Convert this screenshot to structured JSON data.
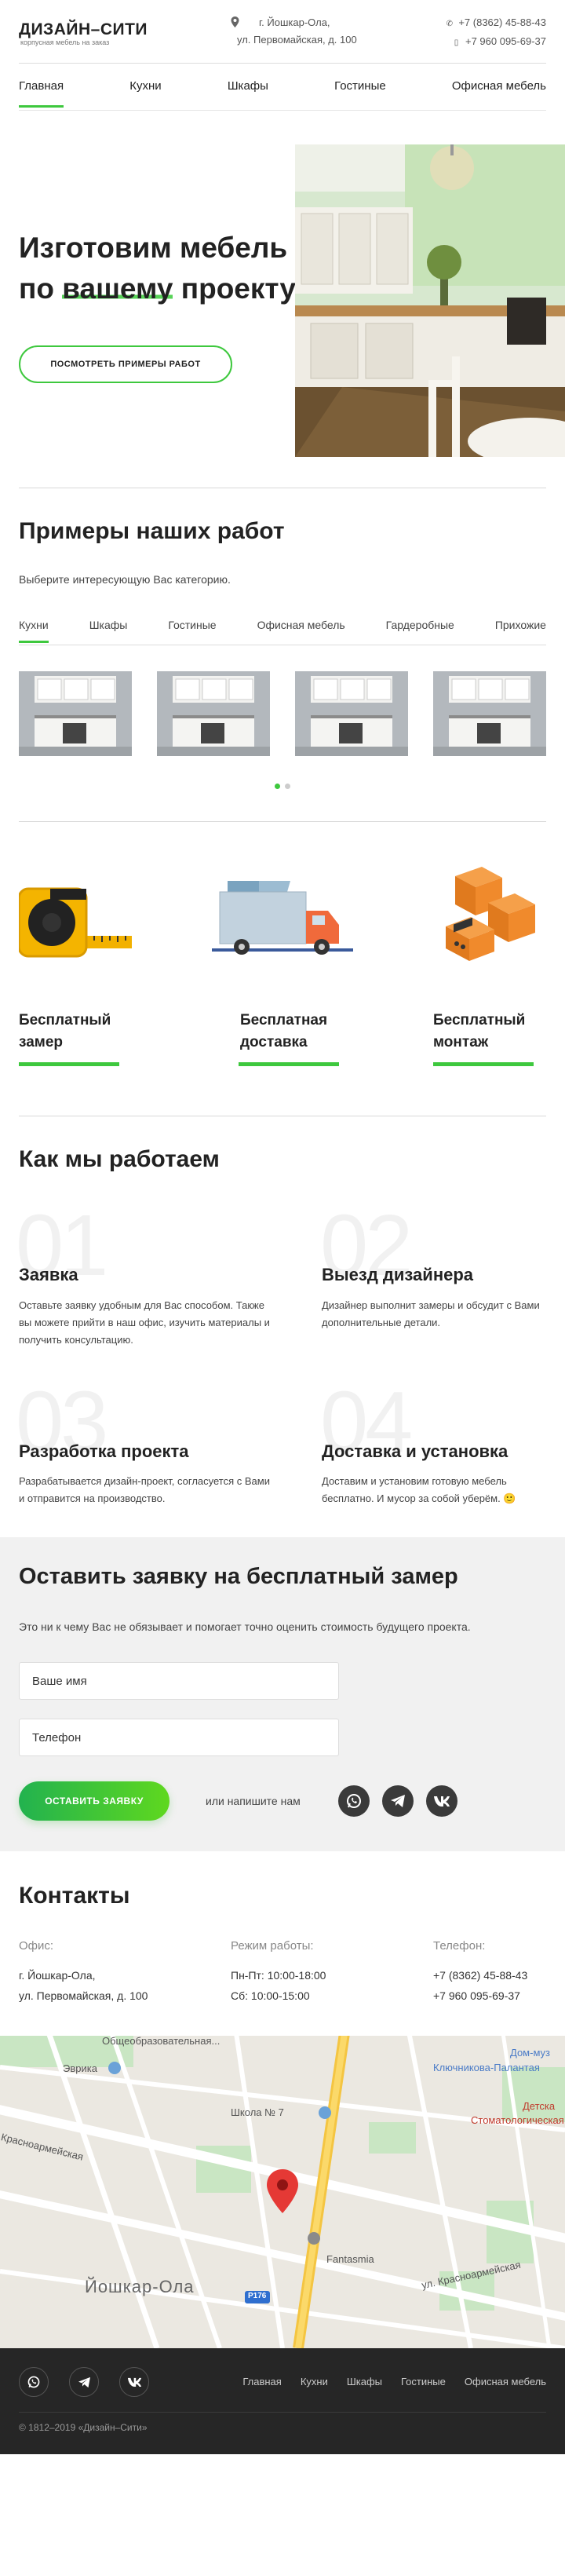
{
  "header": {
    "logo_title": "ДИЗАЙН–СИТИ",
    "logo_subtitle": "корпусная мебель на заказ",
    "address_line1": "г. Йошкар-Ола,",
    "address_line2": "ул. Первомайская, д. 100",
    "phone1": "+7 (8362) 45-88-43",
    "phone2": "+7 960 095-69-37"
  },
  "nav": {
    "items": [
      "Главная",
      "Кухни",
      "Шкафы",
      "Гостиные",
      "Офисная мебель"
    ],
    "active": "Главная"
  },
  "hero": {
    "title_line1": "Изготовим мебель",
    "title_line2_before": "по ",
    "title_line2_highlight": "вашему",
    "title_line2_after": " проекту",
    "button": "ПОСМОТРЕТЬ ПРИМЕРЫ РАБОТ"
  },
  "works": {
    "title": "Примеры наших работ",
    "subtitle": "Выберите интересующую Вас категорию.",
    "tabs": [
      "Кухни",
      "Шкафы",
      "Гостиные",
      "Офисная мебель",
      "Гардеробные",
      "Прихожие"
    ],
    "active_tab": "Кухни",
    "slider_pages": 2,
    "slider_current": 1
  },
  "features": [
    {
      "title": "Бесплатный замер",
      "icon": "tape-measure-icon"
    },
    {
      "title": "Бесплатная доставка",
      "icon": "delivery-truck-icon"
    },
    {
      "title": "Бесплатный монтаж",
      "icon": "furniture-assembly-icon"
    }
  ],
  "how": {
    "title": "Как мы работаем",
    "steps": [
      {
        "num": "01",
        "title": "Заявка",
        "text": "Оставьте заявку удобным для Вас способом. Также вы можете прийти в наш офис, изучить материалы и получить консультацию."
      },
      {
        "num": "02",
        "title": "Выезд дизайнера",
        "text": "Дизайнер выполнит замеры и обсудит с Вами дополнительные детали."
      },
      {
        "num": "03",
        "title": "Разработка проекта",
        "text": "Разрабатывается дизайн-проект, согласуется с Вами и отправится на производство."
      },
      {
        "num": "04",
        "title": "Доставка и установка",
        "text": "Доставим и установим готовую мебель бесплатно. И мусор за собой уберём. 🙂"
      }
    ]
  },
  "request": {
    "title": "Оставить заявку на бесплатный замер",
    "subtitle": "Это ни к чему Вас не обязывает и помогает точно оценить стоимость будущего проекта.",
    "name_placeholder": "Ваше имя",
    "phone_placeholder": "Телефон",
    "button": "ОСТАВИТЬ ЗАЯВКУ",
    "or_text": "или напишите нам"
  },
  "contacts": {
    "title": "Контакты",
    "office_label": "Офис:",
    "office_line1": "г. Йошкар-Ола,",
    "office_line2": "ул. Первомайская, д. 100",
    "hours_label": "Режим работы:",
    "hours_line1": "Пн-Пт: 10:00-18:00",
    "hours_line2": "Сб: 10:00-15:00",
    "phone_label": "Телефон:",
    "phone_line1": "+7 (8362) 45-88-43",
    "phone_line2": "+7 960 095-69-37"
  },
  "map": {
    "labels": [
      "Общеобразовательная...",
      "Эврика",
      "Дом-муз",
      "Ключникова-Палантая",
      "Детска",
      "Стоматологическая",
      "Школа № 7",
      "ул. Красноармейская",
      "Красноармейская",
      "Fantasmia",
      "Йошкар-Ола",
      "Р176"
    ]
  },
  "footer": {
    "nav": [
      "Главная",
      "Кухни",
      "Шкафы",
      "Гостиные",
      "Офисная мебель"
    ],
    "copyright": "© 1812–2019 «Дизайн–Сити»"
  },
  "colors": {
    "accent": "#3ec83e",
    "dark": "#262626",
    "gray_bg": "#f1f1f1"
  }
}
